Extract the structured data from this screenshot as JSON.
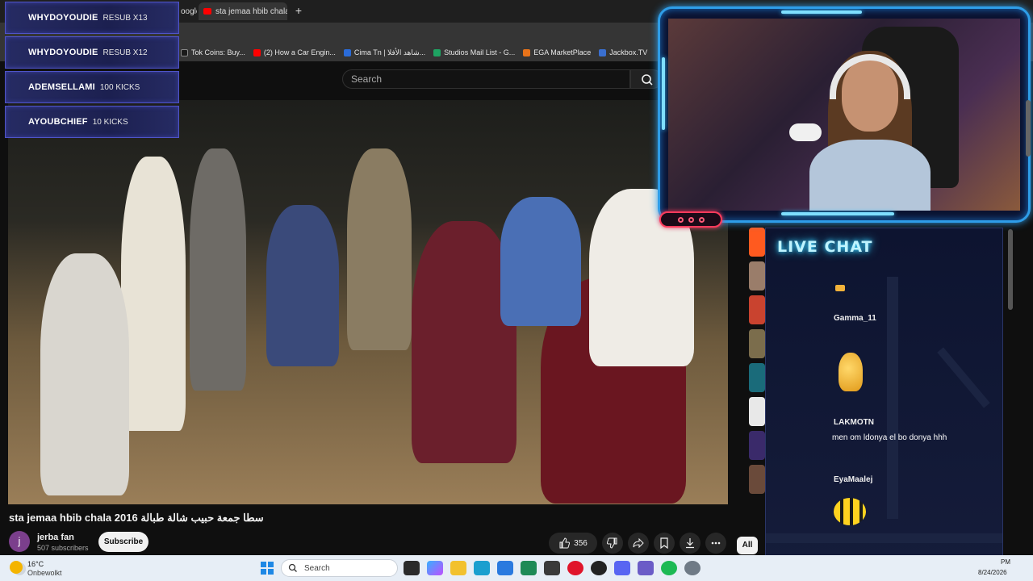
{
  "browser": {
    "tabs": [
      {
        "label": "oogle"
      },
      {
        "label": "sta jemaa hbib chala",
        "close": "×"
      }
    ],
    "new_tab": "+",
    "bookmarks": [
      {
        "label": "Tok Coins: Buy...",
        "color": "#1a1a1a"
      },
      {
        "label": "(2) How a Car Engin...",
        "color": "#ff0000"
      },
      {
        "label": "Cima Tn | شاهد الأفلا...",
        "color": "#2a6bd8"
      },
      {
        "label": "Studios Mail List - G...",
        "color": "#1ea362"
      },
      {
        "label": "EGA MarketPlace",
        "color": "#e8731a"
      },
      {
        "label": "Jackbox.TV",
        "color": "#3a6fd0"
      }
    ]
  },
  "youtube": {
    "search_placeholder": "Search",
    "video_title": "sta jemaa hbib chala 2016 سطا جمعة حبيب شالة طبالة",
    "channel": {
      "avatar_letter": "j",
      "name": "jerba fan",
      "subscribers": "507 subscribers"
    },
    "subscribe_label": "Subscribe",
    "like_count": "356",
    "chip_all": "All"
  },
  "overlay": {
    "alerts": [
      {
        "name": "WHYDOYOUDIE",
        "detail": "RESUB X13"
      },
      {
        "name": "WHYDOYOUDIE",
        "detail": "RESUB X12"
      },
      {
        "name": "ADEMSELLAMI",
        "detail": "100 KICKS"
      },
      {
        "name": "AYOUBCHIEF",
        "detail": "10 KICKS"
      }
    ],
    "chat": {
      "title": "LIVE CHAT",
      "messages": [
        {
          "user": "Gamma_11",
          "text": ""
        },
        {
          "user": "LAKMOTN",
          "text": "men om ldonya el bo donya hhh"
        },
        {
          "user": "EyaMaalej",
          "text": ""
        }
      ]
    }
  },
  "taskbar": {
    "temperature": "16°C",
    "weather": "Onbewolkt",
    "search_placeholder": "Search",
    "time": "PM",
    "date": "8/24/2026"
  }
}
